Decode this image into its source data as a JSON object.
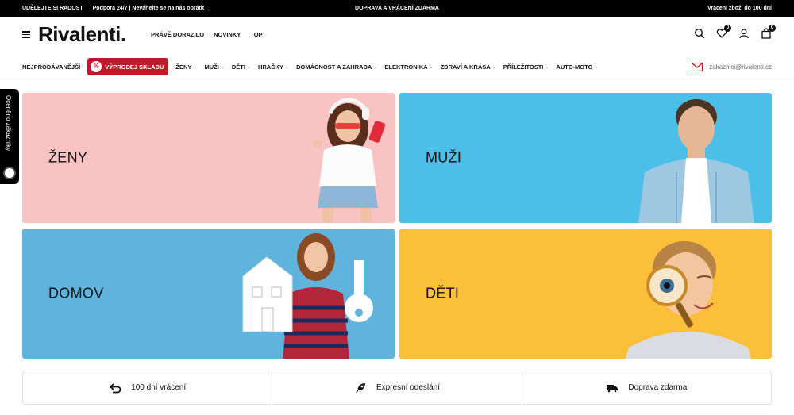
{
  "topbar": {
    "left_promo": "UDĚLEJTE SI RADOST",
    "support": "Podpora 24/7 | Neváhejte se na nás obrátit",
    "center": "DOPRAVA A VRÁCENÍ ZDARMA",
    "right": "Vrácení zboží do 100 dní"
  },
  "header": {
    "logo": "Rivalenti.",
    "nav": [
      "PRÁVĚ DORAZILO",
      "NOVINKY",
      "TOP"
    ],
    "wishlist_count": "0",
    "cart_count": "0",
    "icons": [
      "search-icon",
      "heart-icon",
      "user-icon",
      "bag-icon",
      "menu-icon"
    ]
  },
  "catnav": {
    "bestsellers": "NEJPRODÁVANĚJŠÍ",
    "sale_label": "VÝPRODEJ SKLADU",
    "sale_badge": "%",
    "categories": [
      {
        "label": "ŽENY",
        "chevron": "⌄"
      },
      {
        "label": "MUŽI",
        "chevron": "⌄"
      },
      {
        "label": "DĚTI",
        "chevron": "⌄"
      },
      {
        "label": "HRAČKY",
        "chevron": "⌄"
      },
      {
        "label": "DOMÁCNOST A ZAHRADA",
        "chevron": "⌄"
      },
      {
        "label": "ELEKTRONIKA",
        "chevron": "⌄"
      },
      {
        "label": "ZDRAVÍ A KRÁSA",
        "chevron": "⌄"
      },
      {
        "label": "PŘÍLEŽITOSTI",
        "chevron": "⌄"
      },
      {
        "label": "AUTO-MOTO",
        "chevron": "⌄"
      }
    ],
    "email": "zakaznici@rivalenti.cz"
  },
  "sidetab": {
    "label": "Oceněno zákazníky"
  },
  "tiles": [
    {
      "label": "ŽENY",
      "color": "#f8c3c2"
    },
    {
      "label": "MUŽI",
      "color": "#4bbfe8"
    },
    {
      "label": "DOMOV",
      "color": "#5fb3dc"
    },
    {
      "label": "DĚTI",
      "color": "#fbbf3a"
    }
  ],
  "features": [
    {
      "label": "100 dní vrácení",
      "icon": "return-arrow-icon"
    },
    {
      "label": "Expresní odeslání",
      "icon": "rocket-icon"
    },
    {
      "label": "Doprava zdarma",
      "icon": "truck-icon"
    }
  ],
  "colors": {
    "sale_red": "#c0192b",
    "topbar": "#000000"
  }
}
